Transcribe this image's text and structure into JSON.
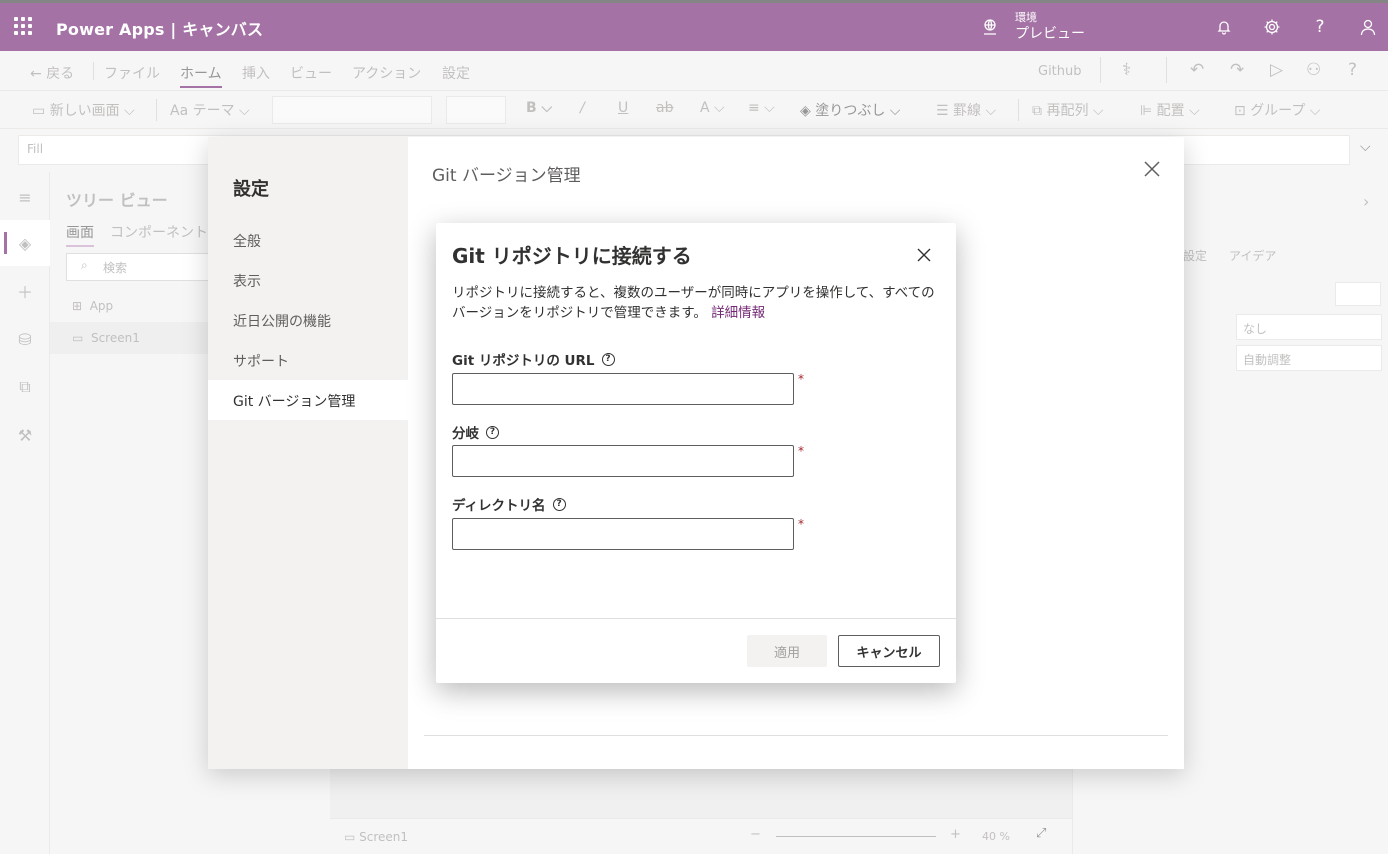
{
  "topbar": {
    "brand": "Power Apps | キャンバス",
    "env_label": "環境",
    "env_value": "プレビュー",
    "icons": [
      "waffle-icon",
      "globe-icon",
      "bell-icon",
      "gear-icon",
      "help-icon",
      "user-icon"
    ]
  },
  "menu": {
    "back": "戻る",
    "items": [
      "ファイル",
      "ホーム",
      "挿入",
      "ビュー",
      "アクション",
      "設定"
    ],
    "active": "ホーム",
    "github": "Github"
  },
  "cmdbar": {
    "new_screen": "新しい画面",
    "theme": "テーマ",
    "fill": "塗りつぶし",
    "border": "罫線",
    "reorder": "再配列",
    "align": "配置",
    "group": "グループ"
  },
  "formula": {
    "property": "Fill"
  },
  "treeview": {
    "title": "ツリー ビュー",
    "tabs": [
      "画面",
      "コンポーネント"
    ],
    "search_placeholder": "検索",
    "items": [
      "App",
      "Screen1"
    ]
  },
  "statusbar": {
    "screen": "Screen1",
    "zoom": "40 %"
  },
  "rightpanel": {
    "tabs": [
      "設定",
      "アイデア"
    ],
    "select1": "なし",
    "select2": "自動調整"
  },
  "settings": {
    "title": "設定",
    "nav": [
      "全般",
      "表示",
      "近日公開の機能",
      "サポート",
      "Git バージョン管理"
    ],
    "active": "Git バージョン管理",
    "heading": "Git バージョン管理"
  },
  "connect": {
    "title": "Git リポジトリに接続する",
    "description": "リポジトリに接続すると、複数のユーザーが同時にアプリを操作して、すべてのバージョンをリポジトリで管理できます。",
    "link": "詳細情報",
    "fields": {
      "url_label": "Git リポジトリの URL",
      "branch_label": "分岐",
      "directory_label": "ディレクトリ名",
      "required_mark": "*"
    },
    "apply_label": "適用",
    "cancel_label": "キャンセル"
  },
  "colors": {
    "brand": "#742774",
    "link": "#742774",
    "required": "#a4262c"
  }
}
